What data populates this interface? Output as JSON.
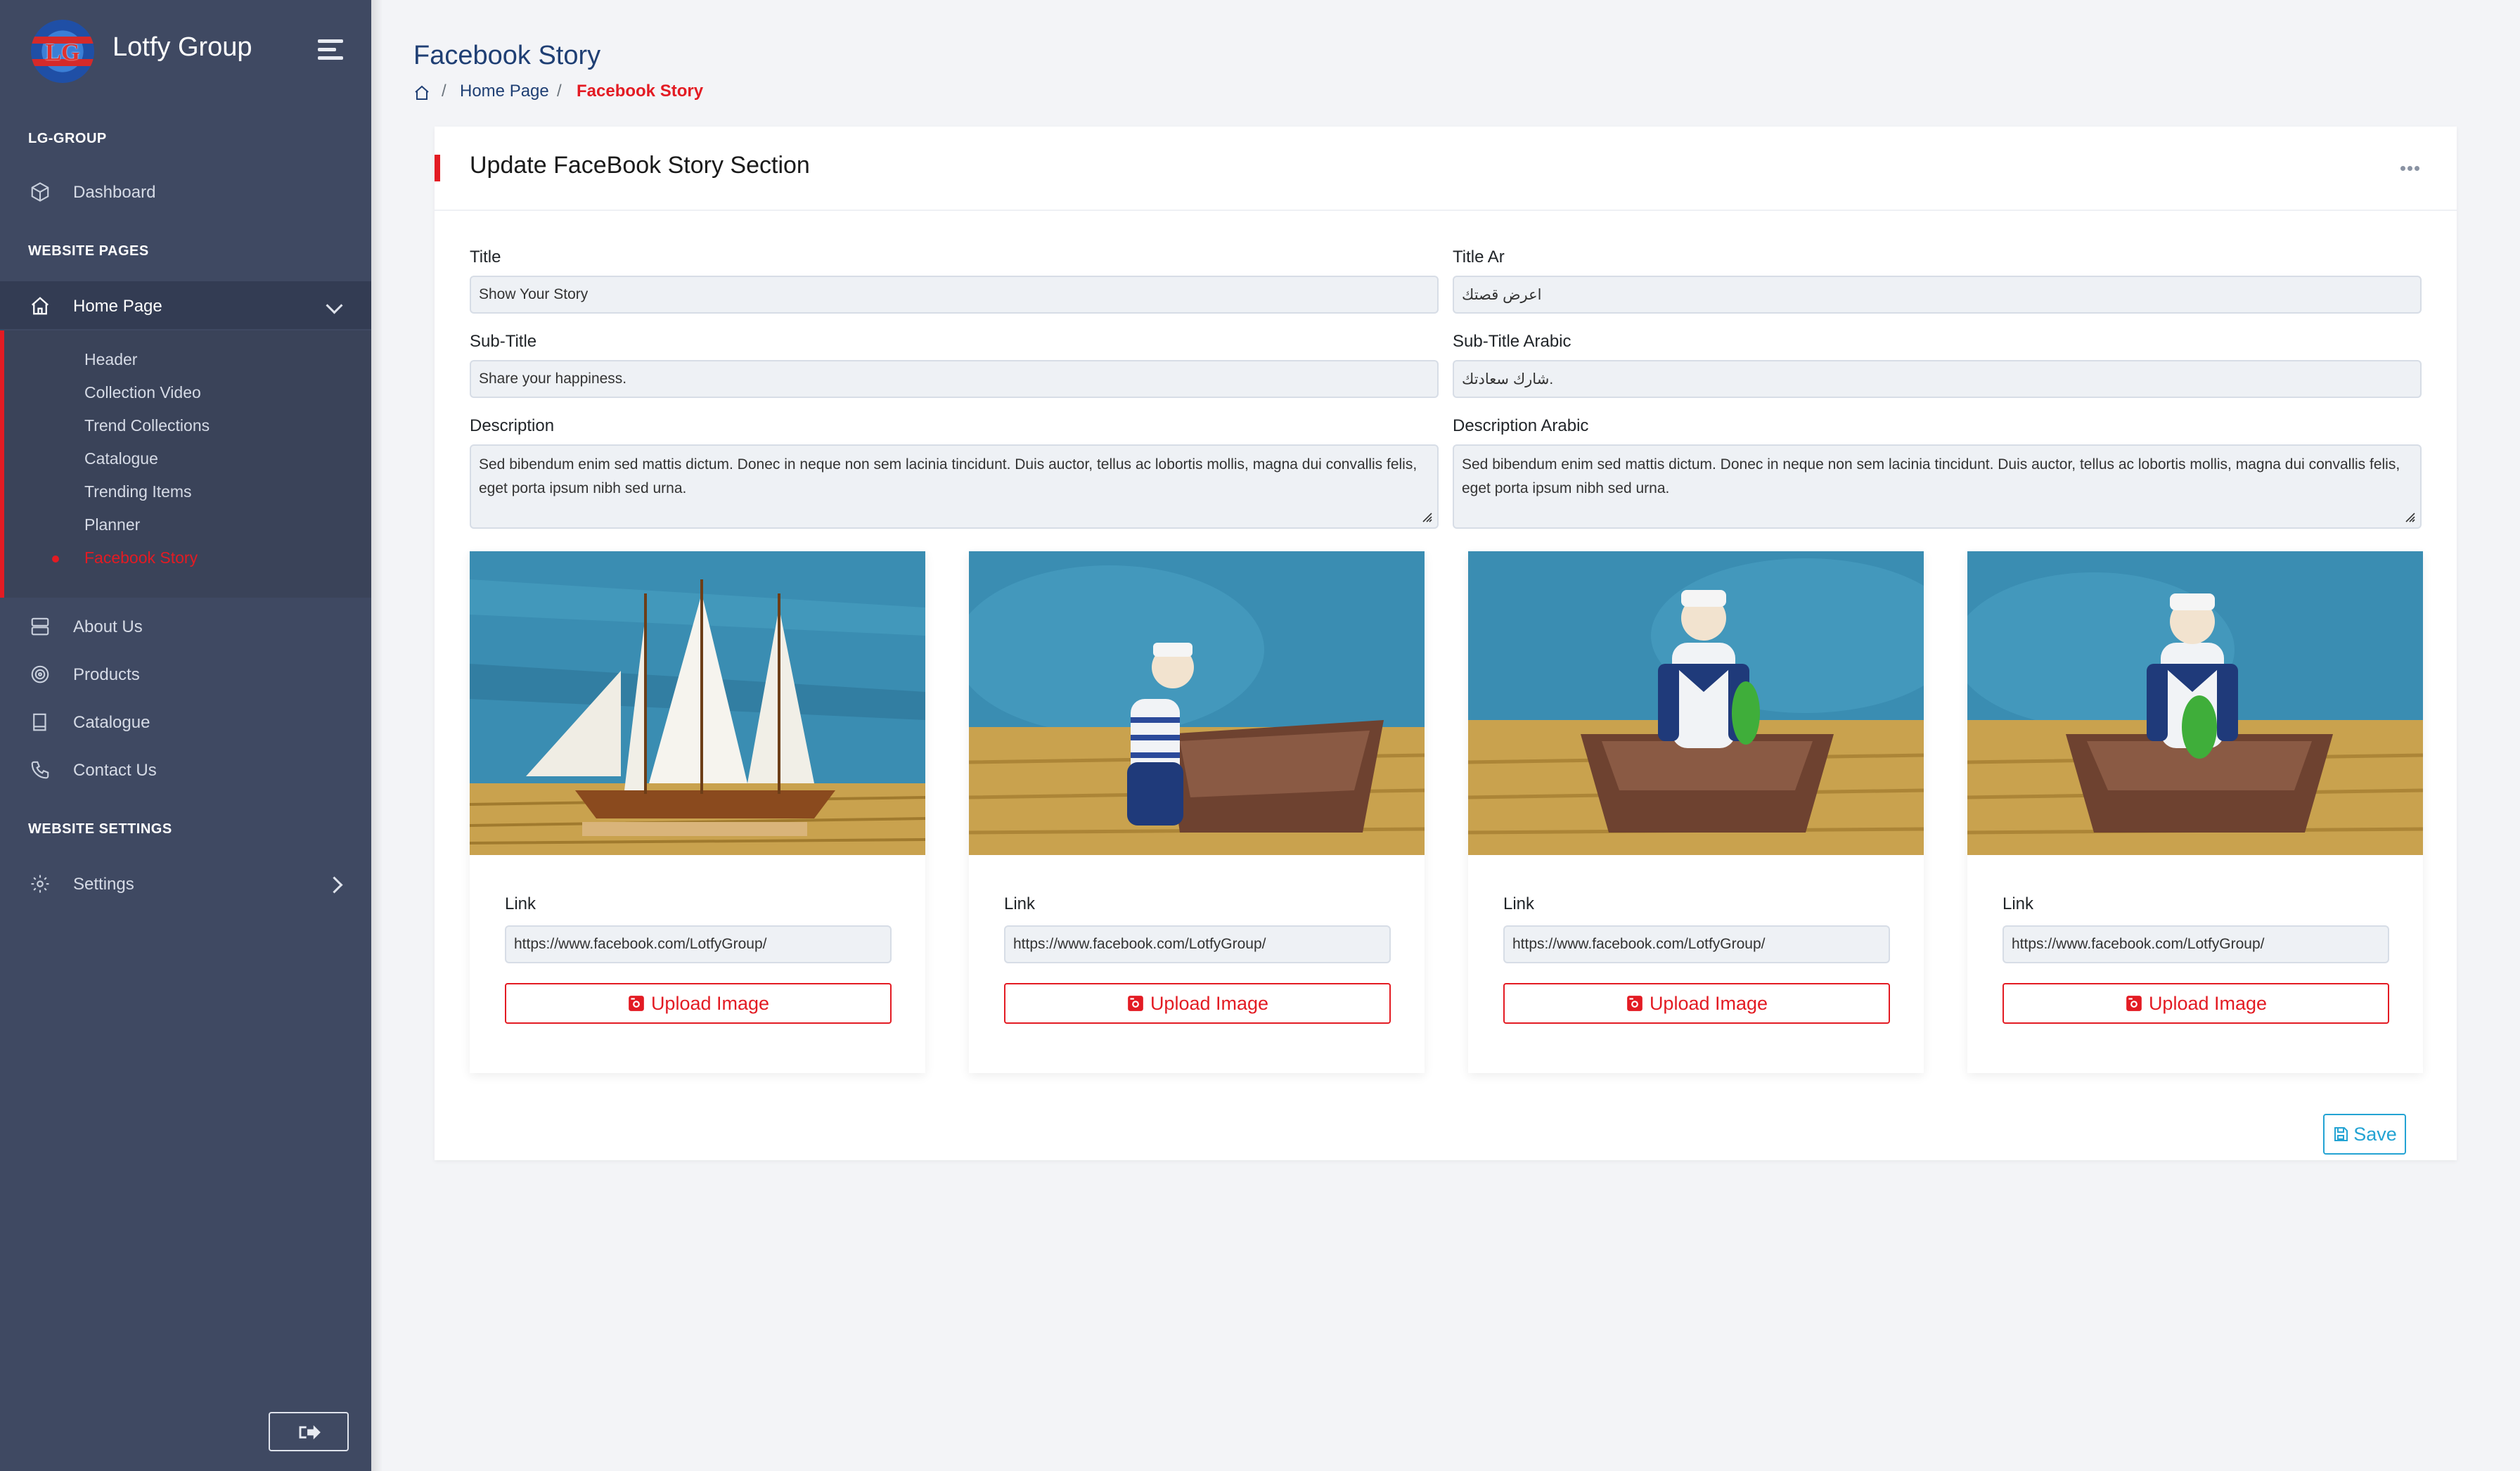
{
  "brand": {
    "logo_text": "LG",
    "name": "Lotfy Group"
  },
  "sidebar": {
    "sections": [
      {
        "title": "LG-GROUP"
      },
      {
        "title": "WEBSITE PAGES"
      },
      {
        "title": "WEBSITE SETTINGS"
      }
    ],
    "items": [
      {
        "label": "Dashboard",
        "icon": "cube-icon"
      },
      {
        "label": "Home Page",
        "icon": "home-icon",
        "active": true,
        "expanded": true
      },
      {
        "label": "About Us",
        "icon": "server-icon"
      },
      {
        "label": "Products",
        "icon": "target-icon"
      },
      {
        "label": "Catalogue",
        "icon": "book-icon"
      },
      {
        "label": "Contact Us",
        "icon": "phone-icon"
      },
      {
        "label": "Settings",
        "icon": "gear-icon"
      }
    ],
    "submenu": [
      {
        "label": "Header"
      },
      {
        "label": "Collection Video"
      },
      {
        "label": "Trend Collections"
      },
      {
        "label": "Catalogue"
      },
      {
        "label": "Trending Items"
      },
      {
        "label": "Planner"
      },
      {
        "label": "Facebook Story",
        "active": true
      }
    ],
    "logout_icon": "sign-out-icon"
  },
  "header": {
    "page_title": "Facebook Story",
    "breadcrumb": [
      {
        "label": "Home Page"
      },
      {
        "label": "Facebook Story",
        "current": true
      }
    ]
  },
  "card": {
    "title": "Update FaceBook Story Section",
    "fields": {
      "title": {
        "label": "Title",
        "value": "Show Your Story"
      },
      "title_ar": {
        "label": "Title Ar",
        "value": "اعرض قصتك"
      },
      "subtitle": {
        "label": "Sub-Title",
        "value": "Share your happiness."
      },
      "subtitle_ar": {
        "label": "Sub-Title Arabic",
        "value": "شارك سعادتك."
      },
      "description": {
        "label": "Description",
        "value": "Sed bibendum enim sed mattis dictum. Donec in neque non sem lacinia tincidunt. Duis auctor, tellus ac lobortis mollis, magna dui convallis felis, eget porta ipsum nibh sed urna."
      },
      "description_ar": {
        "label": "Description Arabic",
        "value": "Sed bibendum enim sed mattis dictum. Donec in neque non sem lacinia tincidunt. Duis auctor, tellus ac lobortis mollis, magna dui convallis felis, eget porta ipsum nibh sed urna."
      }
    },
    "images": [
      {
        "subject": "ship-model",
        "link_label": "Link",
        "link": "https://www.facebook.com/LotfyGroup/",
        "upload_label": "Upload Image"
      },
      {
        "subject": "sailor-figurine-side",
        "link_label": "Link",
        "link": "https://www.facebook.com/LotfyGroup/",
        "upload_label": "Upload Image"
      },
      {
        "subject": "sailor-figurine-front",
        "link_label": "Link",
        "link": "https://www.facebook.com/LotfyGroup/",
        "upload_label": "Upload Image"
      },
      {
        "subject": "sailor-figurine-front",
        "link_label": "Link",
        "link": "https://www.facebook.com/LotfyGroup/",
        "upload_label": "Upload Image"
      }
    ],
    "save_label": "Save"
  },
  "colors": {
    "sidebar_bg": "#3f4962",
    "accent_red": "#e31b23",
    "title_blue": "#1f3f74",
    "save_blue": "#23a3d3"
  }
}
